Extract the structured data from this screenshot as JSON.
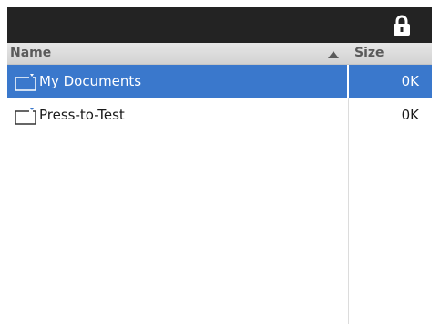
{
  "header": {
    "name_label": "Name",
    "size_label": "Size",
    "sort": "ascending"
  },
  "status_bar": {
    "icon": "lock-icon"
  },
  "files": [
    {
      "name": "My Documents",
      "size": "0K",
      "icon": "folder-icon",
      "selected": true
    },
    {
      "name": "Press-to-Test",
      "size": "0K",
      "icon": "folder-icon",
      "selected": false
    }
  ],
  "colors": {
    "selection": "#3a78cc",
    "status_bar": "#232323",
    "header": "#dcdcdc"
  }
}
